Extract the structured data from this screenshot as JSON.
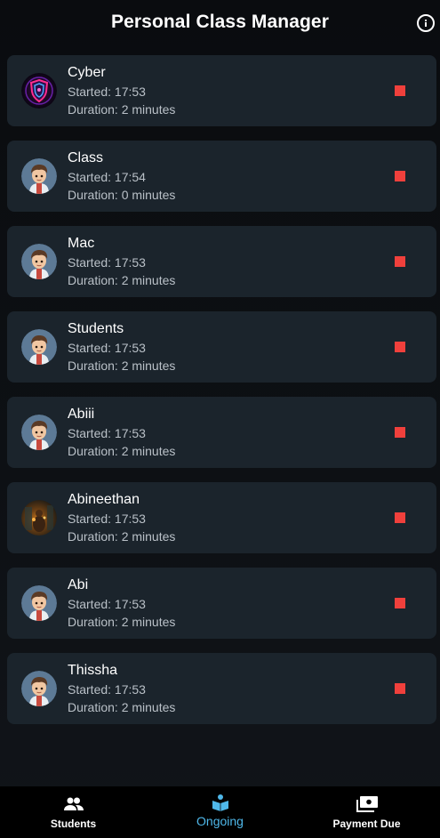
{
  "header": {
    "title": "Personal Class Manager"
  },
  "classes": [
    {
      "name": "Cyber",
      "started": "Started: 17:53",
      "duration": "Duration: 2 minutes",
      "avatar": "shield-avatar"
    },
    {
      "name": "Class",
      "started": "Started: 17:54",
      "duration": "Duration: 0 minutes",
      "avatar": "boy-avatar"
    },
    {
      "name": "Mac",
      "started": "Started: 17:53",
      "duration": "Duration: 2 minutes",
      "avatar": "boy-avatar"
    },
    {
      "name": "Students",
      "started": "Started: 17:53",
      "duration": "Duration: 2 minutes",
      "avatar": "boy-avatar"
    },
    {
      "name": "Abiii",
      "started": "Started: 17:53",
      "duration": "Duration: 2 minutes",
      "avatar": "boy-avatar"
    },
    {
      "name": "Abineethan",
      "started": "Started: 17:53",
      "duration": "Duration: 2 minutes",
      "avatar": "photo-avatar"
    },
    {
      "name": "Abi",
      "started": "Started: 17:53",
      "duration": "Duration: 2 minutes",
      "avatar": "boy-avatar"
    },
    {
      "name": "Thissha",
      "started": "Started: 17:53",
      "duration": "Duration: 2 minutes",
      "avatar": "boy-avatar"
    }
  ],
  "nav": {
    "students": {
      "label": "Students",
      "icon": "people-icon"
    },
    "ongoing": {
      "label": "Ongoing",
      "icon": "reading-book-icon"
    },
    "payment_due": {
      "label": "Payment Due",
      "icon": "payments-icon"
    }
  },
  "colors": {
    "stop": "#f0403c",
    "active_nav": "#4fb8ea",
    "card": "#1b242c"
  }
}
